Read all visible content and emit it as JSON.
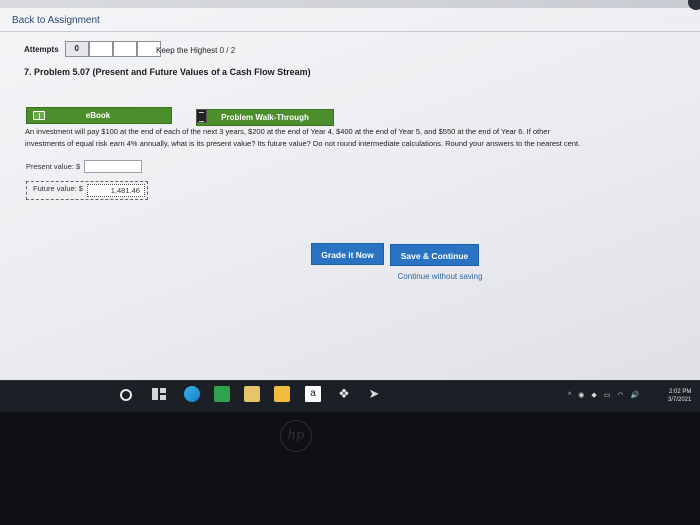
{
  "nav": {
    "back_label": "Back to Assignment"
  },
  "attempts": {
    "label": "Attempts",
    "values": [
      "0",
      "",
      "",
      ""
    ]
  },
  "keep_highest": {
    "label": "Keep the Highest",
    "score": "0 / 2"
  },
  "problem": {
    "title": "7. Problem 5.07 (Present and Future Values of a Cash Flow Stream)",
    "ebook_label": "eBook",
    "walkthrough_label": "Problem Walk-Through",
    "question_line1": "An investment will pay $100 at the end of each of the next 3 years, $200 at the end of Year 4, $400 at the end of Year 5, and $550 at the end of Year 6. If other",
    "question_line2": "investments of equal risk earn 4% annually, what is its present value? Its future value? Do not round intermediate calculations. Round your answers to the nearest cent."
  },
  "fields": {
    "present_label": "Present value:",
    "present_currency": "$",
    "present_value": "",
    "future_label": "Future value:",
    "future_currency": "$",
    "future_value": "1,481.46"
  },
  "actions": {
    "grade_label": "Grade it Now",
    "save_label": "Save & Continue",
    "continue_label": "Continue without saving"
  },
  "taskbar": {
    "icons": [
      "search-icon",
      "task-view-icon",
      "edge-icon",
      "app-icon",
      "calculator-icon",
      "file-explorer-icon",
      "amazon-icon",
      "dropbox-icon",
      "app-arrow-icon"
    ],
    "amazon_glyph": "a",
    "clock_time": "2:02 PM",
    "clock_date": "3/7/2021"
  },
  "hardware": {
    "brand": "hp"
  },
  "colors": {
    "accent_green": "#4b8e2b",
    "accent_blue": "#2a73c2",
    "link_blue": "#2f64a3"
  }
}
